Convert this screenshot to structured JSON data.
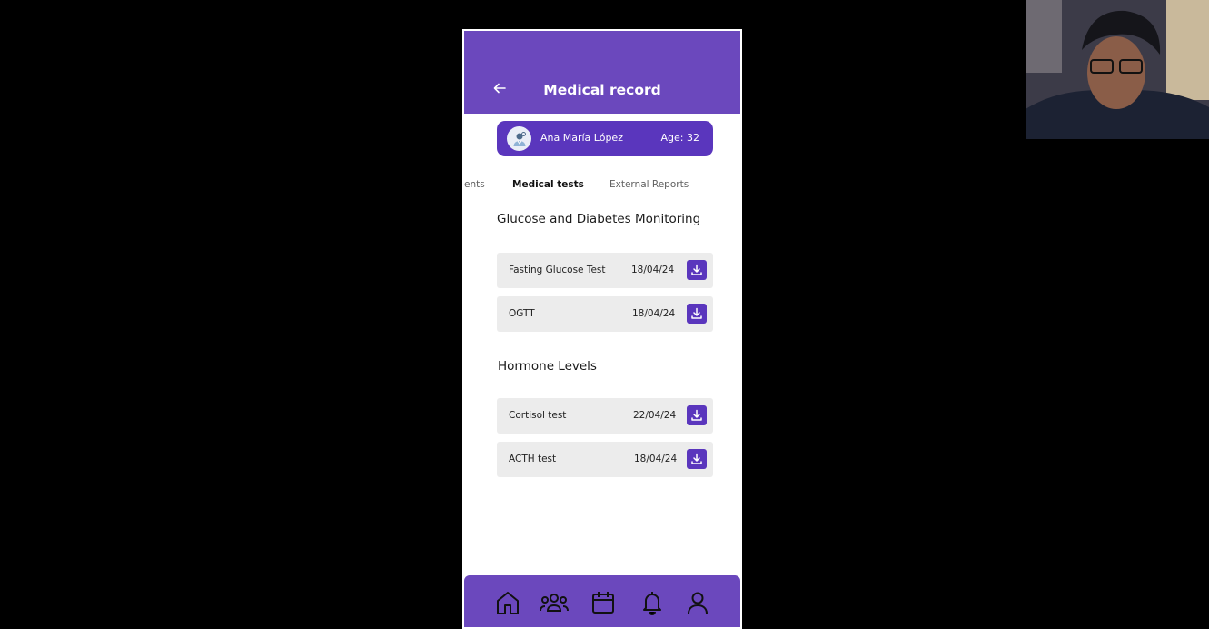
{
  "header": {
    "title": "Medical record",
    "back_icon": "arrow-left-icon"
  },
  "patient": {
    "name": "Ana María López",
    "age": "Age: 32",
    "avatar_icon": "doctor-avatar-icon"
  },
  "tabs": [
    {
      "label": "ents",
      "active": false
    },
    {
      "label": "Medical tests",
      "active": true
    },
    {
      "label": "External Reports",
      "active": false
    }
  ],
  "sections": [
    {
      "title": "Glucose and Diabetes Monitoring",
      "items": [
        {
          "name": "Fasting Glucose Test",
          "date": "18/04/24"
        },
        {
          "name": "OGTT",
          "date": "18/04/24"
        }
      ]
    },
    {
      "title": "Hormone Levels",
      "items": [
        {
          "name": "Cortisol test",
          "date": "22/04/24"
        },
        {
          "name": "ACTH test",
          "date": "18/04/24"
        }
      ]
    }
  ],
  "bottom_nav": [
    "home-icon",
    "group-icon",
    "calendar-icon",
    "bell-icon",
    "profile-icon"
  ],
  "colors": {
    "primary": "#6b48bd",
    "accent": "#5a36bd",
    "row_bg": "#ececec"
  }
}
